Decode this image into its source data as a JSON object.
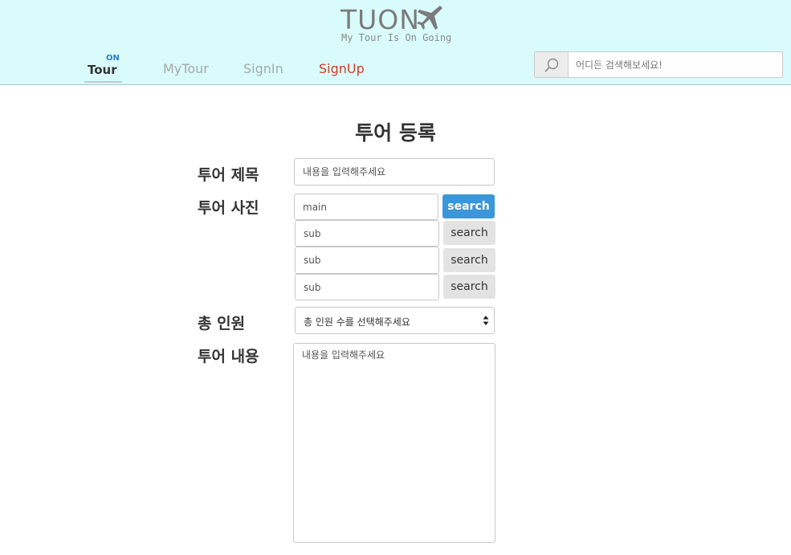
{
  "header": {
    "logo_text": "TUON",
    "tagline": "My Tour Is On Going",
    "nav": {
      "tour": {
        "label": "Tour",
        "badge": "ON"
      },
      "mytour": "MyTour",
      "signin": "SignIn",
      "signup": "SignUp"
    },
    "search": {
      "placeholder": "어디든 검색해보세요!"
    }
  },
  "form": {
    "title": "투어 등록",
    "title_label": "투어 제목",
    "title_placeholder": "내용을 입력해주세요",
    "photo_label": "투어 사진",
    "photos": [
      {
        "placeholder": "main",
        "button": "search"
      },
      {
        "placeholder": "sub",
        "button": "search"
      },
      {
        "placeholder": "sub",
        "button": "search"
      },
      {
        "placeholder": "sub",
        "button": "search"
      }
    ],
    "people_label": "총 인원",
    "people_select": "총 인원 수를 선택해주세요",
    "content_label": "투어 내용",
    "content_placeholder": "내용을 입력해주세요"
  },
  "colors": {
    "header_bg": "#d9fbfb",
    "primary_button": "#3b97d9",
    "signup_link": "#d33b26",
    "on_badge": "#2a7fc1"
  },
  "icons": {
    "plane": "airplane-icon",
    "search": "search-icon",
    "select_arrows": "updown-arrow-icon"
  }
}
